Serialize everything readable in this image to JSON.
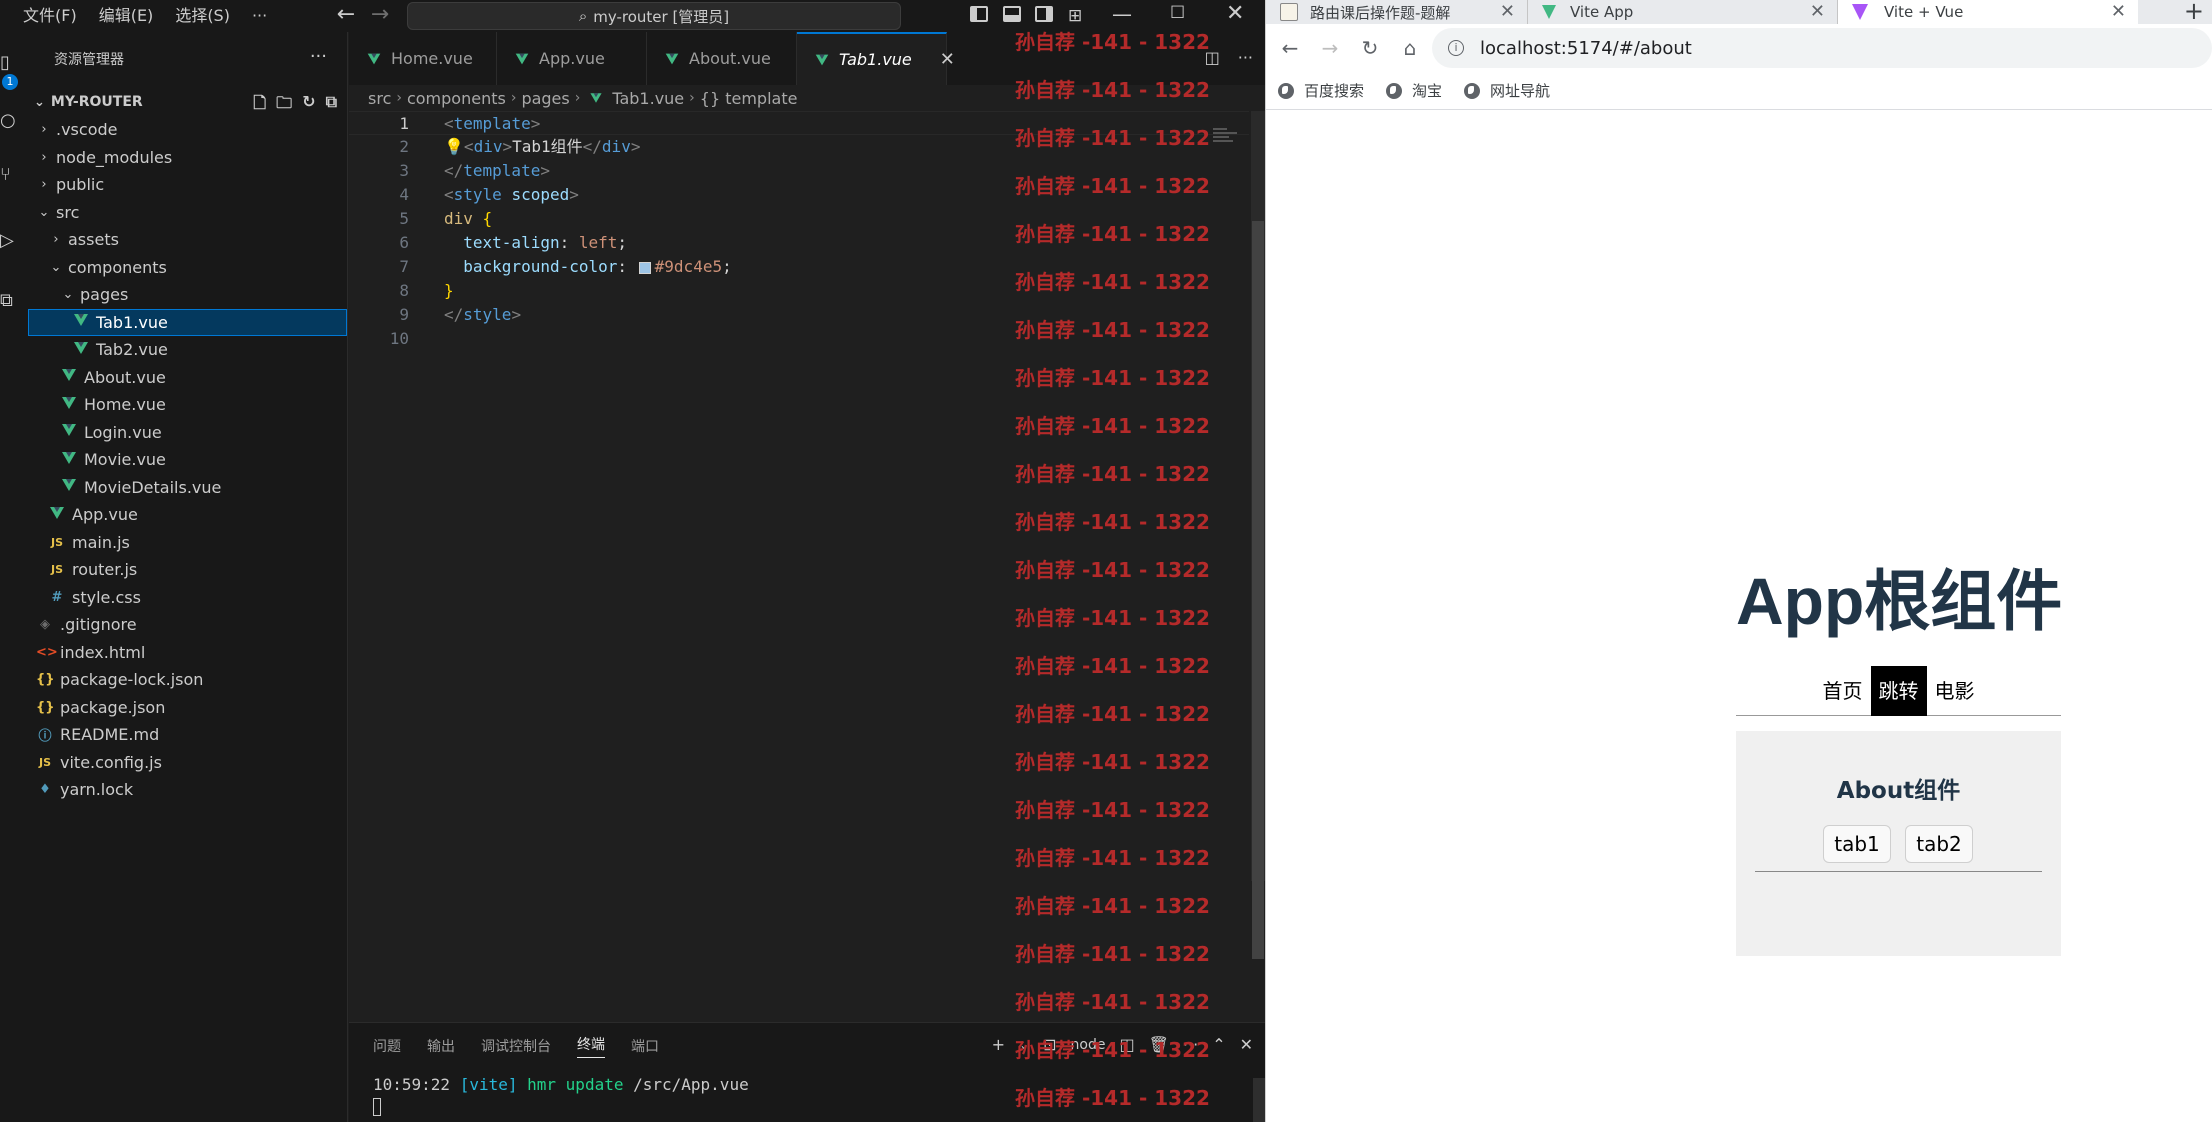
{
  "vscode": {
    "menu": [
      "文件(F)",
      "编辑(E)",
      "选择(S)",
      "···"
    ],
    "command_center": "my-router [管理员]",
    "activity_badge": "1",
    "sidebar_title": "资源管理器",
    "sidebar_more": "···",
    "workspace": "MY-ROUTER",
    "tree": [
      {
        "name": ".vscode",
        "depth": 0,
        "kind": "folder",
        "open": false
      },
      {
        "name": "node_modules",
        "depth": 0,
        "kind": "folder",
        "open": false
      },
      {
        "name": "public",
        "depth": 0,
        "kind": "folder",
        "open": false
      },
      {
        "name": "src",
        "depth": 0,
        "kind": "folder",
        "open": true
      },
      {
        "name": "assets",
        "depth": 1,
        "kind": "folder",
        "open": false
      },
      {
        "name": "components",
        "depth": 1,
        "kind": "folder",
        "open": true
      },
      {
        "name": "pages",
        "depth": 2,
        "kind": "folder",
        "open": true
      },
      {
        "name": "Tab1.vue",
        "depth": 3,
        "kind": "vue",
        "selected": true
      },
      {
        "name": "Tab2.vue",
        "depth": 3,
        "kind": "vue"
      },
      {
        "name": "About.vue",
        "depth": 2,
        "kind": "vue"
      },
      {
        "name": "Home.vue",
        "depth": 2,
        "kind": "vue"
      },
      {
        "name": "Login.vue",
        "depth": 2,
        "kind": "vue"
      },
      {
        "name": "Movie.vue",
        "depth": 2,
        "kind": "vue"
      },
      {
        "name": "MovieDetails.vue",
        "depth": 2,
        "kind": "vue"
      },
      {
        "name": "App.vue",
        "depth": 1,
        "kind": "vue"
      },
      {
        "name": "main.js",
        "depth": 1,
        "kind": "js"
      },
      {
        "name": "router.js",
        "depth": 1,
        "kind": "js"
      },
      {
        "name": "style.css",
        "depth": 1,
        "kind": "css"
      },
      {
        "name": ".gitignore",
        "depth": 0,
        "kind": "git"
      },
      {
        "name": "index.html",
        "depth": 0,
        "kind": "html"
      },
      {
        "name": "package-lock.json",
        "depth": 0,
        "kind": "json"
      },
      {
        "name": "package.json",
        "depth": 0,
        "kind": "json"
      },
      {
        "name": "README.md",
        "depth": 0,
        "kind": "info"
      },
      {
        "name": "vite.config.js",
        "depth": 0,
        "kind": "js"
      },
      {
        "name": "yarn.lock",
        "depth": 0,
        "kind": "yarn"
      }
    ],
    "tabs": [
      {
        "label": "Home.vue",
        "dirty": true,
        "active": false
      },
      {
        "label": "App.vue",
        "dirty": false,
        "active": false
      },
      {
        "label": "About.vue",
        "dirty": false,
        "active": false
      },
      {
        "label": "Tab1.vue",
        "dirty": false,
        "active": true
      }
    ],
    "breadcrumb": [
      "src",
      "components",
      "pages",
      "Tab1.vue",
      "{} template"
    ],
    "code_lines": [
      "<template>",
      "  <div>Tab1组件</div>",
      "</template>",
      "<style scoped>",
      "div {",
      "  text-align: left;",
      "  background-color: #9dc4e5;",
      "}",
      "</style>",
      ""
    ],
    "swatch_color": "#9dc4e5",
    "current_line": 1,
    "panel_tabs": [
      "问题",
      "输出",
      "调试控制台",
      "终端",
      "端口"
    ],
    "active_panel_tab": "终端",
    "terminal_label": "node",
    "terminal": {
      "time": "10:59:22",
      "tag": "[vite]",
      "msg": "hmr update",
      "path": "/src/App.vue"
    },
    "watermark": "孙自荐 -141 - 1322"
  },
  "browser": {
    "tabs": [
      {
        "title": "路由课后操作题-题解",
        "favicon": "doc-icon"
      },
      {
        "title": "Vite App",
        "favicon": "vite-icon"
      },
      {
        "title": "Vite + Vue",
        "favicon": "vite-icon",
        "active": true
      }
    ],
    "new_tab": "+",
    "url": "localhost:5174/#/about",
    "bookmarks": [
      "百度搜索",
      "淘宝",
      "网址导航"
    ],
    "page": {
      "title": "App根组件",
      "nav": [
        {
          "label": "首页",
          "active": false
        },
        {
          "label": "跳转",
          "active": true
        },
        {
          "label": "电影",
          "active": false
        }
      ],
      "about_title": "About组件",
      "about_tabs": [
        "tab1",
        "tab2"
      ]
    }
  }
}
